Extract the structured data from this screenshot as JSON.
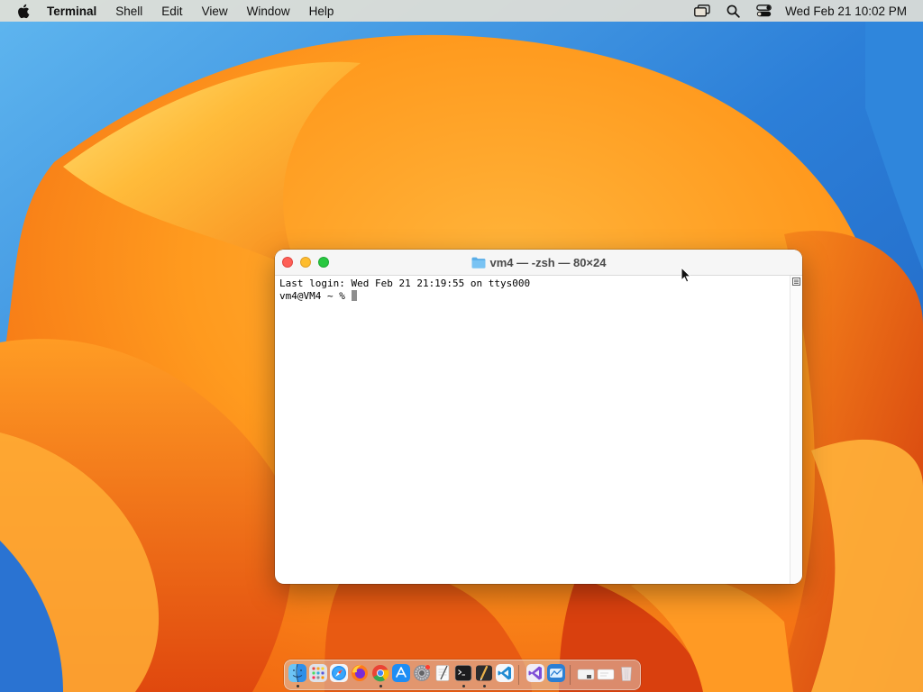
{
  "menubar": {
    "app_name": "Terminal",
    "items": [
      "Shell",
      "Edit",
      "View",
      "Window",
      "Help"
    ],
    "clock": "Wed Feb 21  10:02 PM",
    "status_icons": [
      "screen-mirroring-icon",
      "spotlight-search-icon",
      "control-center-icon"
    ]
  },
  "window": {
    "title": "vm4 — -zsh — 80×24",
    "lines": [
      "Last login: Wed Feb 21 21:19:55 on ttys000",
      "vm4@VM4 ~ % "
    ]
  },
  "dock": {
    "apps": [
      "finder-icon",
      "launchpad-icon",
      "safari-icon",
      "firefox-icon",
      "chrome-icon",
      "app-store-icon",
      "system-settings-icon",
      "textedit-icon",
      "terminal-icon",
      "script-editor-icon",
      "vscode-icon",
      "visual-studio-icon",
      "utility-app-icon",
      "downloads-icon",
      "documents-icon",
      "trash-icon"
    ],
    "running": [
      "finder",
      "chrome",
      "terminal",
      "script-editor"
    ]
  }
}
